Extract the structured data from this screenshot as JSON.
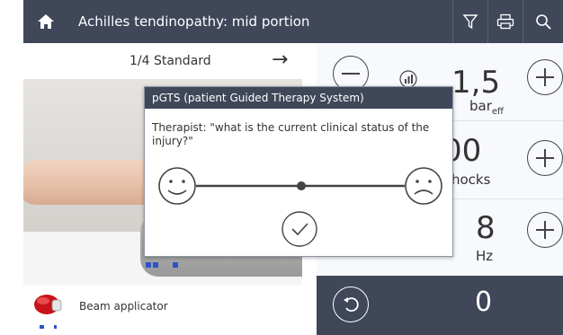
{
  "header": {
    "title": "Achilles tendinopathy: mid portion",
    "icons": [
      "home-icon",
      "filter-icon",
      "printer-icon",
      "search-icon"
    ]
  },
  "pager": {
    "label": "1/4 Standard",
    "next_icon": "arrow-right-icon"
  },
  "applicator": {
    "label": "Beam applicator"
  },
  "parameters": {
    "pressure": {
      "value": "1,5",
      "unit": "bar",
      "unit_sub": "eff"
    },
    "shocks": {
      "value": "00",
      "unit": "hocks"
    },
    "frequency": {
      "value": "8",
      "unit": "Hz"
    },
    "counter": {
      "value": "0"
    }
  },
  "dialog": {
    "title": "pGTS (patient Guided Therapy System)",
    "question": "Therapist: \"what is the current clinical status of the injury?\"",
    "scale": {
      "left_icon": "happy-face-icon",
      "right_icon": "sad-face-icon"
    },
    "confirm_icon": "check-circle-icon"
  },
  "colors": {
    "header": "#3f4759",
    "accent_blue": "#2d55c8",
    "panel_bg": "#f7f9fc"
  }
}
